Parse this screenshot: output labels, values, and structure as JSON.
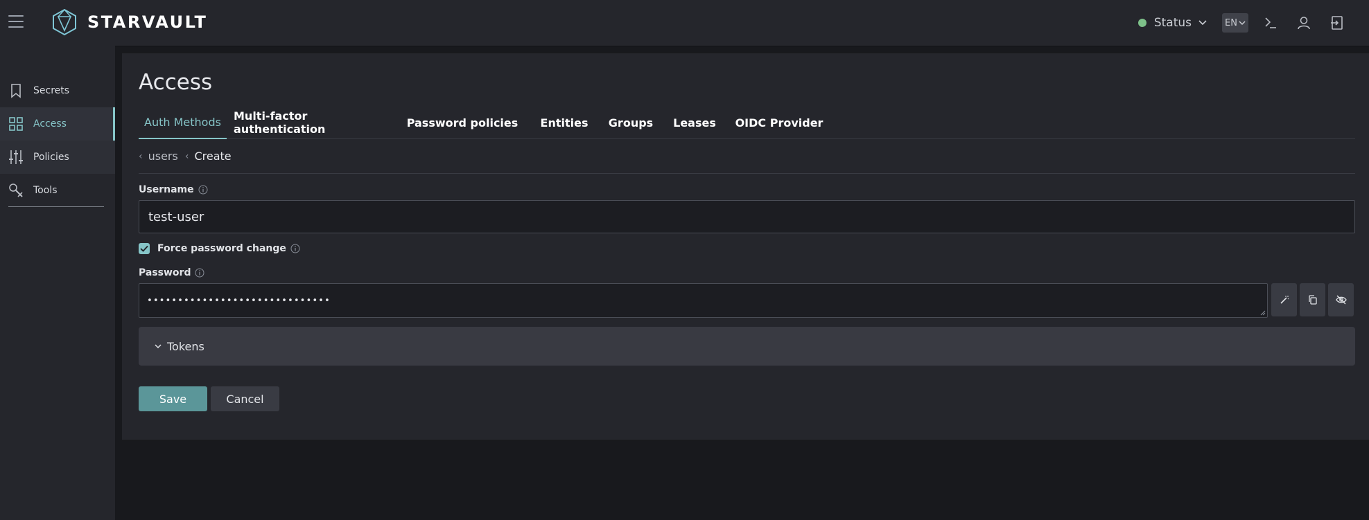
{
  "app": {
    "logo_text": "STARVAULT"
  },
  "header": {
    "status_label": "Status",
    "status_color": "#7dc089",
    "lang_label": "EN",
    "icons": [
      "terminal-icon",
      "user-icon",
      "logout-icon"
    ]
  },
  "sidebar": {
    "items": [
      {
        "label": "Secrets",
        "icon": "bookmark-icon"
      },
      {
        "label": "Access",
        "icon": "grid-icon",
        "active": true
      },
      {
        "label": "Policies",
        "icon": "sliders-icon"
      },
      {
        "label": "Tools",
        "icon": "tools-icon"
      }
    ]
  },
  "page": {
    "title": "Access",
    "tabs": [
      {
        "label": "Auth Methods",
        "active": true
      },
      {
        "label": "Multi-factor authentication"
      },
      {
        "label": "Password policies"
      },
      {
        "label": "Entities"
      },
      {
        "label": "Groups"
      },
      {
        "label": "Leases"
      },
      {
        "label": "OIDC Provider"
      }
    ],
    "breadcrumb": {
      "parent": "users",
      "current": "Create"
    }
  },
  "form": {
    "username_label": "Username",
    "username_value": "test-user",
    "force_password_label": "Force password change",
    "force_password_checked": true,
    "password_label": "Password",
    "password_masked": "••••••••••••••••••••••••••••••",
    "tokens_label": "Tokens",
    "save_label": "Save",
    "cancel_label": "Cancel"
  },
  "colors": {
    "accent": "#86c5c8",
    "primary_button": "#5b9699",
    "panel": "#25262c",
    "background": "#18191d"
  }
}
